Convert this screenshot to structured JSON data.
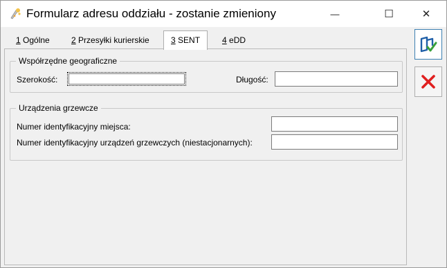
{
  "window": {
    "title": "Formularz adresu oddziału - zostanie zmieniony",
    "minimize_glyph": "—",
    "maximize_glyph": "☐",
    "close_glyph": "✕"
  },
  "tabs": [
    {
      "hotkey": "1",
      "label": " Ogólne"
    },
    {
      "hotkey": "2",
      "label": " Przesyłki kurierskie"
    },
    {
      "hotkey": "3",
      "label": " SENT"
    },
    {
      "hotkey": "4",
      "label": " eDD"
    }
  ],
  "active_tab": 2,
  "geo": {
    "legend": "Współrzędne geograficzne",
    "lat_label": "Szerokość:",
    "lat_value": "",
    "lon_label": "Długość:",
    "lon_value": ""
  },
  "devices": {
    "legend": "Urządzenia grzewcze",
    "place_id_label": "Numer identyfikacyjny miejsca:",
    "place_id_value": "",
    "device_id_label": "Numer identyfikacyjny urządzeń grzewczych (niestacjonarnych):",
    "device_id_value": ""
  },
  "side_buttons": {
    "save_icon": "save-confirm-icon",
    "cancel_icon": "cancel-icon"
  },
  "colors": {
    "save_blue": "#1f5fa8",
    "save_check": "#3aa13a",
    "cancel_red": "#e02020"
  }
}
